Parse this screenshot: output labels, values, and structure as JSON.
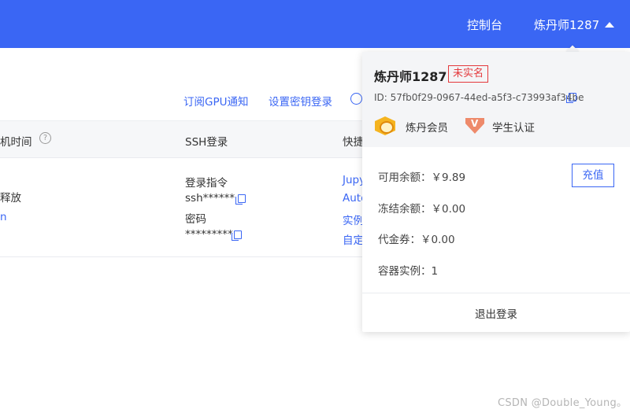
{
  "header": {
    "console_label": "控制台",
    "username": "炼丹师1287"
  },
  "actions": {
    "gpu_notice": "订阅GPU通知",
    "ssh_key_login": "设置密钥登录"
  },
  "table": {
    "columns": [
      "机时间",
      "SSH登录",
      "快捷"
    ],
    "row": {
      "status_text": "释放",
      "status_sub": "n",
      "login_cmd_label": "登录指令",
      "login_cmd_value": "ssh******",
      "password_label": "密码",
      "password_value": "*********",
      "shortcuts": [
        "Jupy",
        "Auto",
        "实例",
        "自定"
      ]
    }
  },
  "popover": {
    "name": "炼丹师1287",
    "verify_status": "未实名",
    "id_text": "ID: 57fb0f29-0967-44ed-a5f3-c73993af34be",
    "badges": {
      "member": "炼丹会员",
      "student": "学生认证",
      "student_mark": "V"
    },
    "balance": "可用余额：￥9.89",
    "recharge_label": "充值",
    "frozen": "冻结余额：￥0.00",
    "voucher": "代金券：￥0.00",
    "instances": "容器实例：1",
    "logout": "退出登录"
  },
  "watermark": "CSDN @Double_Young。",
  "colors": {
    "brand": "#3a66f4",
    "danger": "#e4393c"
  }
}
